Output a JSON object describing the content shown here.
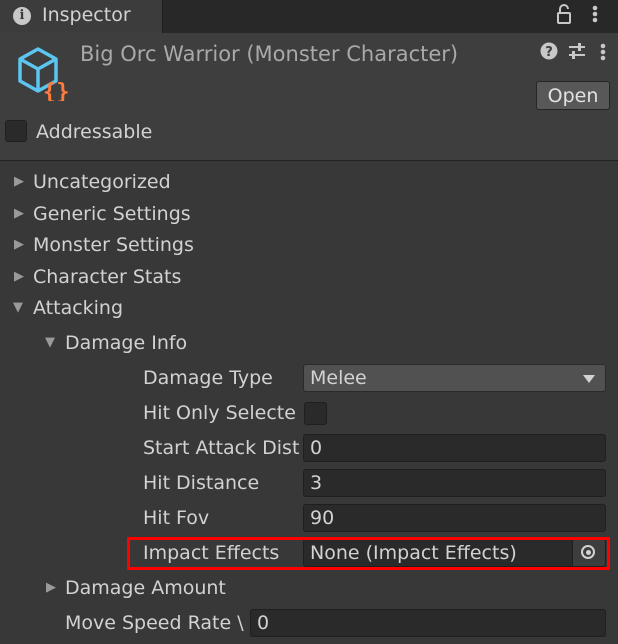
{
  "tab": {
    "label": "Inspector",
    "info_icon": "info-icon",
    "lock_icon": "lock-icon",
    "menu_icon": "kebab-menu-icon"
  },
  "header": {
    "title": "Big Orc Warrior (Monster Character)",
    "asset_icon": "script-cube-icon",
    "help_icon": "help-icon",
    "presets_icon": "sliders-icon",
    "menu_icon": "kebab-menu-icon",
    "open_label": "Open",
    "addressable_label": "Addressable"
  },
  "sections": [
    {
      "label": "Uncategorized",
      "expanded": false
    },
    {
      "label": "Generic Settings",
      "expanded": false
    },
    {
      "label": "Monster Settings",
      "expanded": false
    },
    {
      "label": "Character Stats",
      "expanded": false
    },
    {
      "label": "Attacking",
      "expanded": true
    }
  ],
  "damage_info": {
    "label": "Damage Info",
    "fields": {
      "damage_type": {
        "label": "Damage Type",
        "value": "Melee"
      },
      "hit_only_selected": {
        "label": "Hit Only Selecte"
      },
      "start_attack_dist": {
        "label": "Start Attack Dist",
        "value": "0"
      },
      "hit_distance": {
        "label": "Hit Distance",
        "value": "3"
      },
      "hit_fov": {
        "label": "Hit Fov",
        "value": "90"
      },
      "impact_effects": {
        "label": "Impact Effects",
        "value": "None (Impact Effects)"
      }
    }
  },
  "damage_amount": {
    "label": "Damage Amount"
  },
  "move_speed_rate": {
    "label": "Move Speed Rate \\",
    "value": "0"
  },
  "colors": {
    "highlight": "#ff0000",
    "background": "#383838",
    "field": "#2a2a2a"
  }
}
